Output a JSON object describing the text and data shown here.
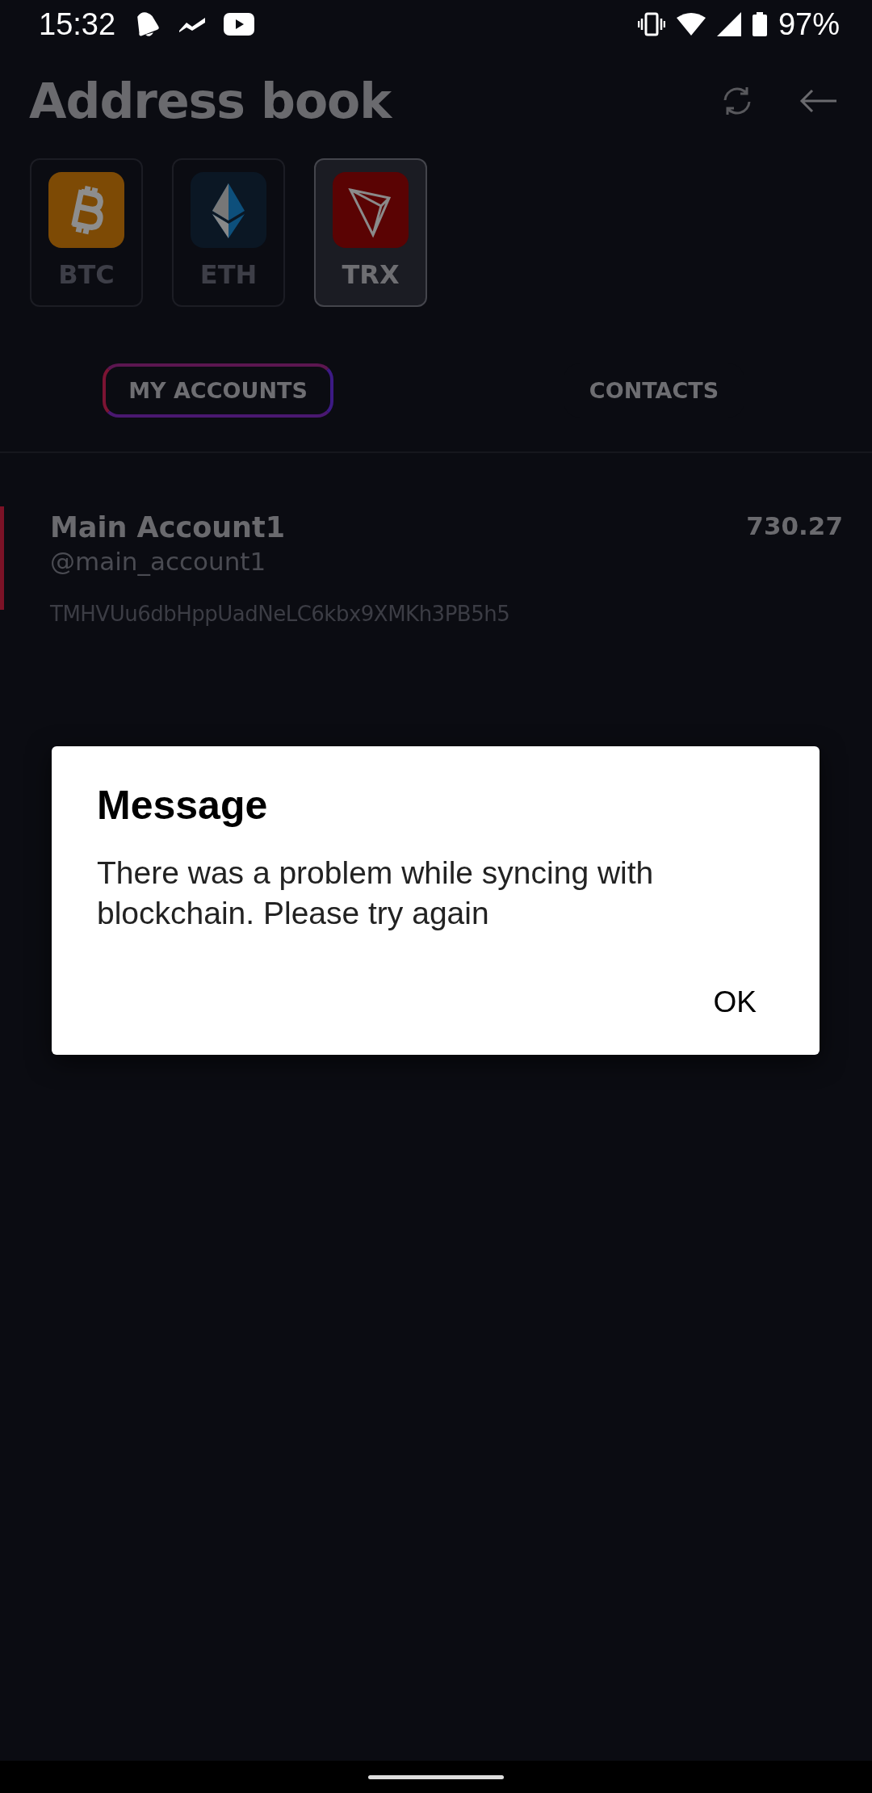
{
  "status_bar": {
    "time": "15:32",
    "battery": "97%"
  },
  "header": {
    "title": "Address book"
  },
  "coins": [
    {
      "label": "BTC",
      "kind": "bitcoin",
      "selected": false
    },
    {
      "label": "ETH",
      "kind": "ethereum",
      "selected": false
    },
    {
      "label": "TRX",
      "kind": "tron",
      "selected": true
    }
  ],
  "tabs": [
    {
      "label": "MY ACCOUNTS",
      "selected": true
    },
    {
      "label": "CONTACTS",
      "selected": false
    }
  ],
  "accounts": [
    {
      "name": "Main Account1",
      "handle": "@main_account1",
      "address": "TMHVUu6dbHppUadNeLC6kbx9XMKh3PB5h5",
      "balance": "730.27",
      "selected": true
    }
  ],
  "dialog": {
    "title": "Message",
    "message": "There was a problem while syncing with blockchain. Please try again",
    "button": "OK"
  }
}
